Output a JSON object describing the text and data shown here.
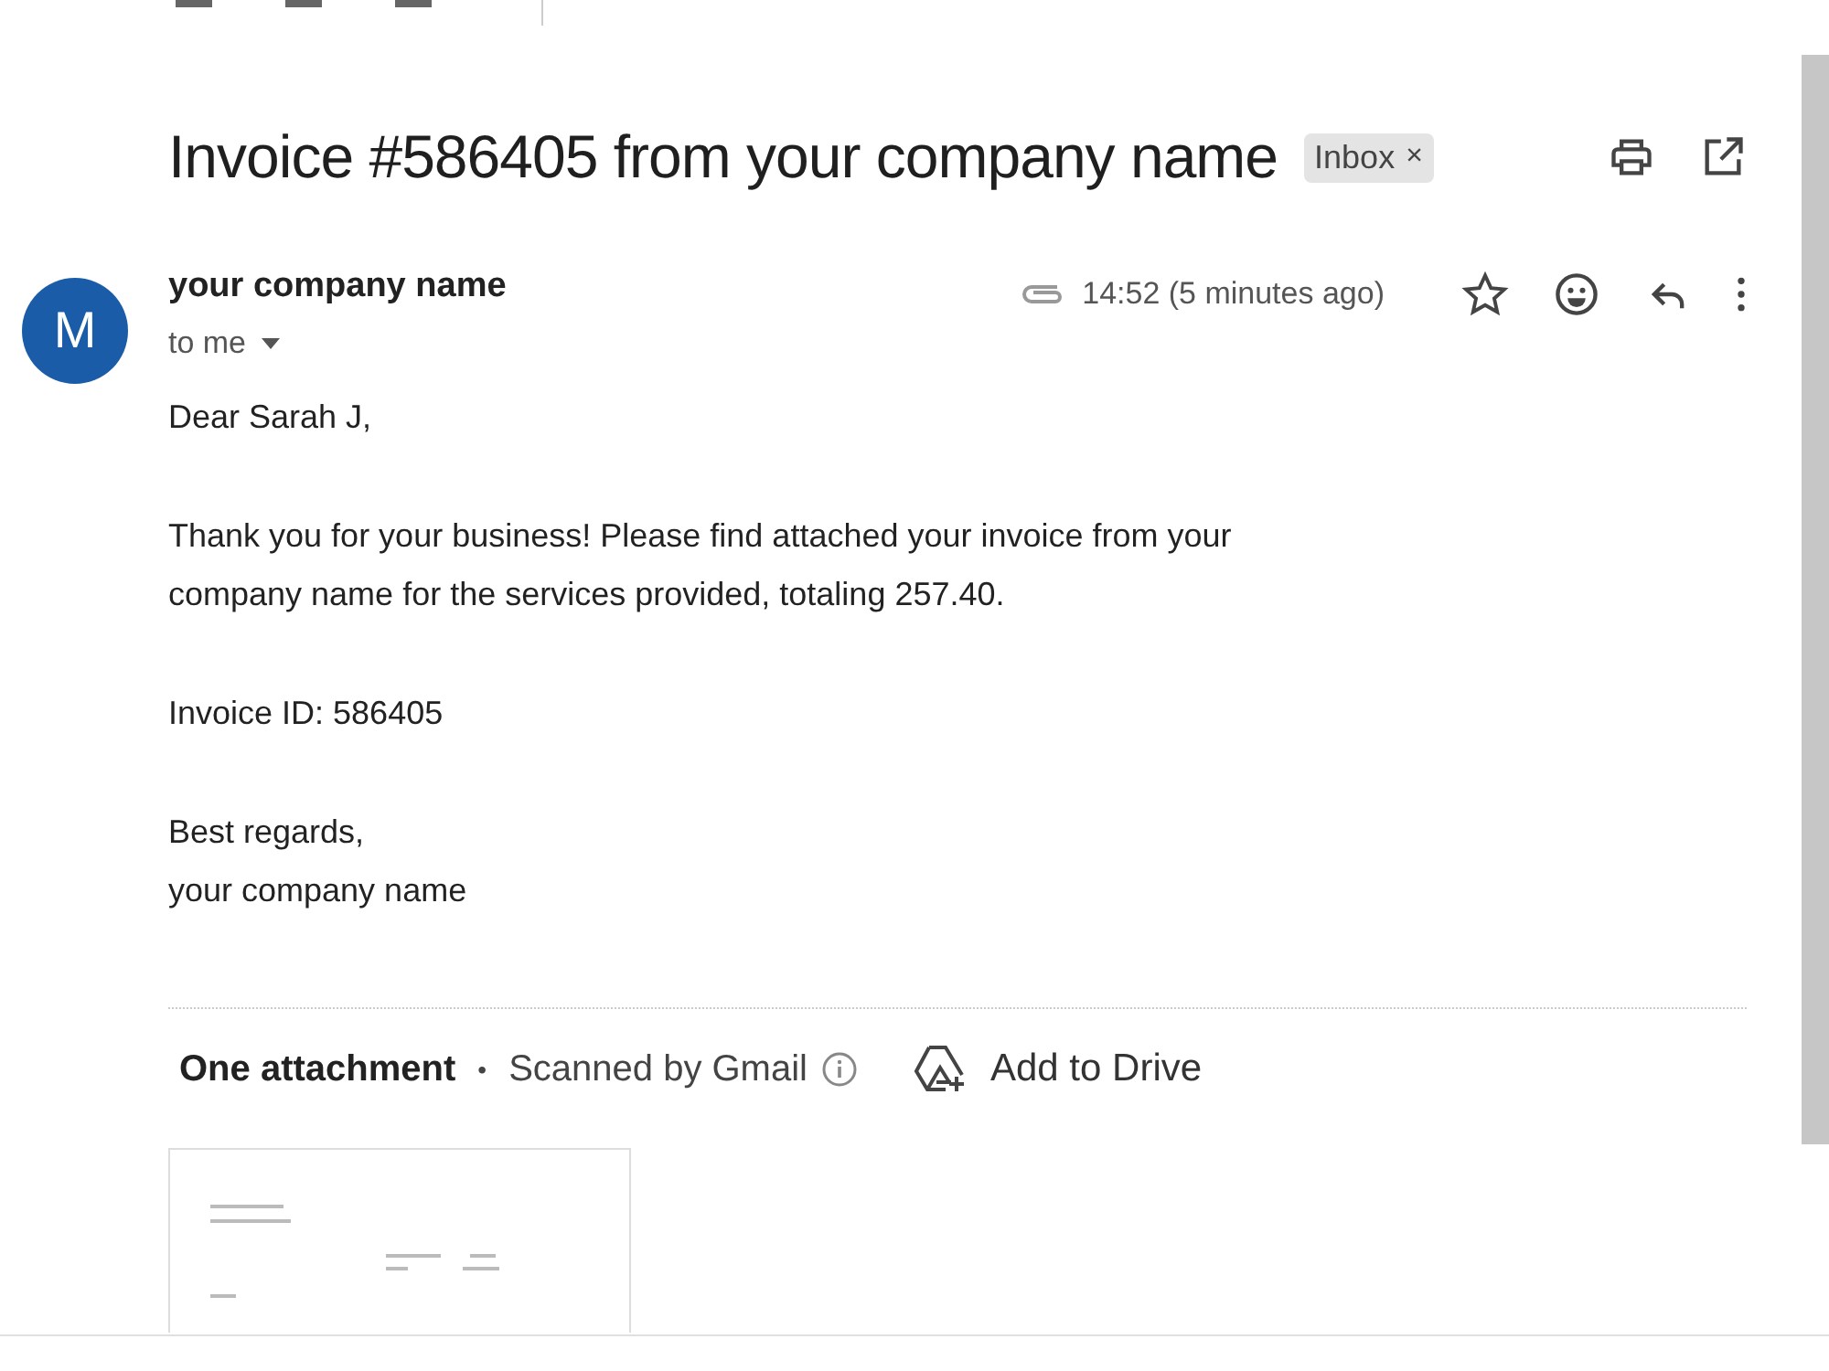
{
  "subject": {
    "title": "Invoice #586405 from your company name",
    "label": "Inbox",
    "label_remove": "×"
  },
  "message": {
    "avatar_letter": "M",
    "sender": "your company name",
    "recipient": "to me",
    "time": "14:52 (5 minutes ago)",
    "has_attachment": true,
    "starred": false
  },
  "body": [
    "Dear Sarah J,",
    "Thank you for your business! Please find attached your invoice from your company name for the services provided, totaling 257.40.",
    "Invoice ID: 586405",
    "Best regards,\nyour company name"
  ],
  "attachments": {
    "title": "One attachment",
    "separator": "•",
    "scan_note": "Scanned by Gmail",
    "action": "Add to Drive"
  }
}
